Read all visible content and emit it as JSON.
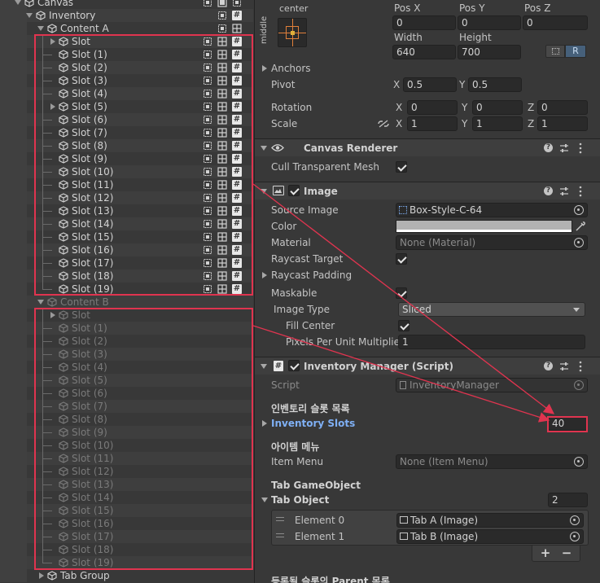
{
  "hierarchy": {
    "canvas": "Canvas",
    "inventory": "Inventory",
    "content_a": "Content A",
    "content_b": "Content B",
    "tab_group": "Tab Group",
    "slots": [
      "Slot",
      "Slot (1)",
      "Slot (2)",
      "Slot (3)",
      "Slot (4)",
      "Slot (5)",
      "Slot (6)",
      "Slot (7)",
      "Slot (8)",
      "Slot (9)",
      "Slot (10)",
      "Slot (11)",
      "Slot (12)",
      "Slot (13)",
      "Slot (14)",
      "Slot (15)",
      "Slot (16)",
      "Slot (17)",
      "Slot (18)",
      "Slot (19)"
    ]
  },
  "rect_transform": {
    "anchor_preset_h": "center",
    "anchor_preset_v": "middle",
    "pos_x_label": "Pos X",
    "pos_x": "0",
    "pos_y_label": "Pos Y",
    "pos_y": "0",
    "pos_z_label": "Pos Z",
    "pos_z": "0",
    "width_label": "Width",
    "width": "640",
    "height_label": "Height",
    "height": "700",
    "r_button": "R",
    "anchors_label": "Anchors",
    "pivot_label": "Pivot",
    "pivot_x": "0.5",
    "pivot_y": "0.5",
    "rotation_label": "Rotation",
    "rot_x": "0",
    "rot_y": "0",
    "rot_z": "0",
    "scale_label": "Scale",
    "scale_x": "1",
    "scale_y": "1",
    "scale_z": "1",
    "x": "X",
    "y": "Y",
    "z": "Z"
  },
  "canvas_renderer": {
    "title": "Canvas Renderer",
    "cull_label": "Cull Transparent Mesh"
  },
  "image": {
    "title": "Image",
    "source_image_label": "Source Image",
    "source_image": "Box-Style-C-64",
    "color_label": "Color",
    "color_value": "#b2b2b2",
    "material_label": "Material",
    "material": "None (Material)",
    "raycast_target_label": "Raycast Target",
    "raycast_padding_label": "Raycast Padding",
    "maskable_label": "Maskable",
    "image_type_label": "Image Type",
    "image_type": "Sliced",
    "fill_center_label": "Fill Center",
    "ppu_label": "Pixels Per Unit Multiplier",
    "ppu": "1"
  },
  "inventory_manager": {
    "title": "Inventory Manager (Script)",
    "script_label": "Script",
    "script": "InventoryManager",
    "slot_list_header": "인벤토리 슬롯 목록",
    "inventory_slots_label": "Inventory Slots",
    "inventory_slots_count": "40",
    "item_menu_header": "아이템 메뉴",
    "item_menu_label": "Item Menu",
    "item_menu": "None (Item Menu)",
    "tab_go_header": "Tab GameObject",
    "tab_object_label": "Tab Object",
    "tab_object_count": "2",
    "elements": [
      {
        "label": "Element 0",
        "value": "Tab A (Image)"
      },
      {
        "label": "Element 1",
        "value": "Tab B (Image)"
      }
    ],
    "add": "+",
    "remove": "−",
    "parent_list_header": "등록될 슬롯의 Parent 목록"
  },
  "colors": {
    "highlight_box": "#e0344f",
    "link_blue": "#7fb0f5"
  },
  "icons": {
    "gameobject": "cube-icon",
    "canvas_renderer": "eye-icon",
    "image": "image-icon",
    "script": "hash-icon",
    "help": "question-icon",
    "settings": "sliders-icon",
    "menu": "kebab-icon"
  }
}
